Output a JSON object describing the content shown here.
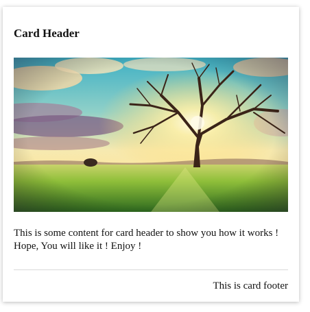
{
  "card": {
    "header": "Card Header",
    "content": "This is some content for card header to show you how it works ! Hope, You will like it ! Enjoy !",
    "footer": "This is card footer"
  }
}
